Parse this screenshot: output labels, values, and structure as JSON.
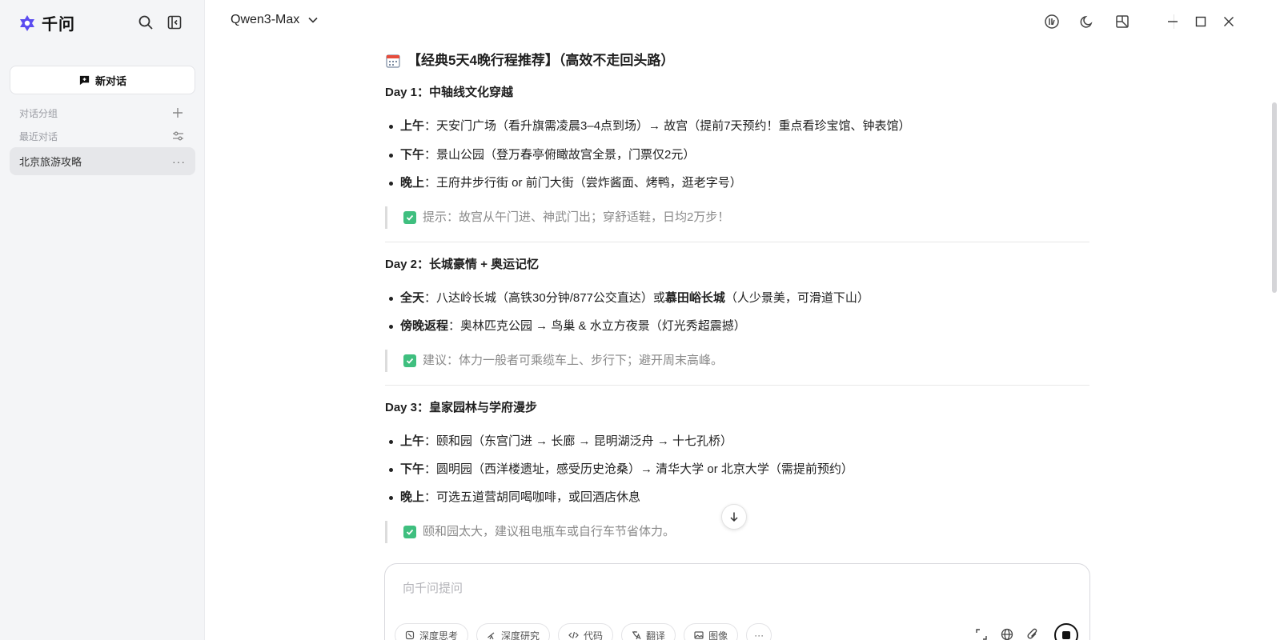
{
  "app": {
    "name": "千问"
  },
  "sidebar": {
    "new_chat_label": "新对话",
    "groups_label": "对话分组",
    "recent_label": "最近对话",
    "items": [
      {
        "label": "北京旅游攻略",
        "more": "···"
      }
    ]
  },
  "header": {
    "model": "Qwen3-Max"
  },
  "content": {
    "title": "【经典5天4晚行程推荐】（高效不走回头路）",
    "day1": {
      "heading": "Day 1：中轴线文化穿越",
      "b1_key": "上午",
      "b1_text": "：天安门广场（看升旗需凌晨3–4点到场）→ 故宫（提前7天预约！重点看珍宝馆、钟表馆）",
      "b2_key": "下午",
      "b2_text": "：景山公园（登万春亭俯瞰故宫全景，门票仅2元）",
      "b3_key": "晚上",
      "b3_text": "：王府井步行街 or 前门大街（尝炸酱面、烤鸭，逛老字号）",
      "tip": "提示：故宫从午门进、神武门出；穿舒适鞋，日均2万步！"
    },
    "day2": {
      "heading": "Day 2：长城豪情 + 奥运记忆",
      "b1_key": "全天",
      "b1_text_a": "：八达岭长城（高铁30分钟/877公交直达）或 ",
      "b1_bold": "慕田峪长城",
      "b1_text_b": "（人少景美，可滑道下山）",
      "b2_key": "傍晚返程",
      "b2_text": "：奥林匹克公园 → 鸟巢 & 水立方夜景（灯光秀超震撼）",
      "tip": "建议：体力一般者可乘缆车上、步行下；避开周末高峰。"
    },
    "day3": {
      "heading": "Day 3：皇家园林与学府漫步",
      "b1_key": "上午",
      "b1_text": "：颐和园（东宫门进 → 长廊 → 昆明湖泛舟 → 十七孔桥）",
      "b2_key": "下午",
      "b2_text": "：圆明园（西洋楼遗址，感受历史沧桑）→ 清华大学 or 北京大学（需提前预约）",
      "b3_key": "晚上",
      "b3_text": "：可选五道营胡同喝咖啡，或回酒店休息",
      "tip": "颐和园太大，建议租电瓶车或自行车节省体力。"
    }
  },
  "composer": {
    "placeholder": "向千问提问",
    "chips": [
      "深度思考",
      "深度研究",
      "代码",
      "翻译",
      "图像"
    ],
    "more": "···"
  },
  "icons": {
    "brand": "qwen-logo-icon",
    "search": "search-icon",
    "sidebar_toggle": "sidebar-collapse-icon",
    "calendar": "calendar-icon",
    "check": "check-box-icon",
    "scroll_down": "arrow-down-icon"
  },
  "colors": {
    "accent": "#5b4cf0",
    "check": "#3fbf7f",
    "sidebar_bg": "#f4f5f7"
  }
}
